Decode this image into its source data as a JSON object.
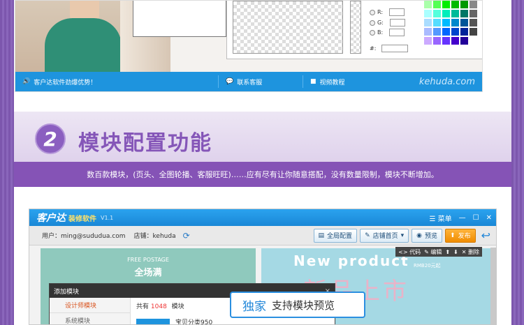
{
  "top": {
    "color_picker": {
      "r_label": "R:",
      "g_label": "G:",
      "b_label": "B:",
      "hex_label": "#:"
    },
    "bottom_bar": {
      "promo": "客户达软件劲爆优势！",
      "service": "联系客服",
      "video": "视频教程",
      "brand": "kehuda.com"
    },
    "swatches": [
      "#aaffaa",
      "#55ff55",
      "#00ee00",
      "#00bb00",
      "#009900",
      "#888888",
      "#aaffff",
      "#55ffdd",
      "#00eebb",
      "#00bb99",
      "#007766",
      "#666666",
      "#aaddff",
      "#55ddff",
      "#00bbff",
      "#0088cc",
      "#005599",
      "#555555",
      "#aabbff",
      "#5599ff",
      "#0066ff",
      "#0044cc",
      "#002299",
      "#444444",
      "#ccaaff",
      "#9966ff",
      "#6633ff",
      "#4400cc",
      "#220099",
      "#ffffff"
    ]
  },
  "section": {
    "number": "2",
    "title": "模块配置功能",
    "subtitle": "数百款模块，(页头、全图轮播、客服旺旺)……应有尽有让你随意搭配，没有数量限制，模块不断增加。"
  },
  "app": {
    "logo": "客户达",
    "logo_sub": "装修软件",
    "version": "V1.1",
    "menu": "菜单",
    "user_label": "用户：ming@sududua.com",
    "shop_label": "店铺：kehuda",
    "buttons": {
      "global": "全局配置",
      "shop_home": "店铺首页",
      "preview": "预览",
      "publish": "发布"
    },
    "ctrl": {
      "code": "代码",
      "edit": "编辑",
      "delete": "删除"
    },
    "canvas": {
      "free_postage": "FREE POSTAGE",
      "full_free": "全场满",
      "new_product": "New  product",
      "rmb": "RMB20元起",
      "new_arrival": "新品上市"
    },
    "dialog": {
      "title": "添加模块",
      "close": "×",
      "side_items": [
        "设计师模块",
        "系统模块"
      ],
      "total_prefix": "共有",
      "total_count": "1048",
      "total_suffix": "模块",
      "item": "宝贝分类950"
    },
    "callout": {
      "highlight": "独家",
      "text": "支持模块预览"
    }
  }
}
